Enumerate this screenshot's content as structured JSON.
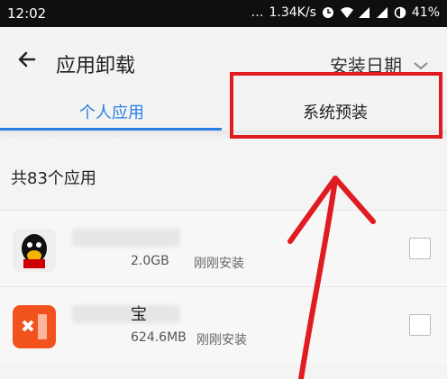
{
  "status": {
    "time": "12:02",
    "network_speed": "1.34K/s",
    "battery_level": "41%"
  },
  "header": {
    "title": "应用卸载",
    "sort_label": "安装日期",
    "tabs": [
      {
        "label": "个人应用",
        "active": true
      },
      {
        "label": "系统预装",
        "active": false
      }
    ]
  },
  "app_count": "共83个应用",
  "apps": [
    {
      "name_suffix": "",
      "size": "2.0GB",
      "install_status": "刚刚安装"
    },
    {
      "name_suffix": "宝",
      "size": "624.6MB",
      "install_status": "刚刚安装"
    }
  ],
  "colors": {
    "accent": "#2a7fe0",
    "annotation": "#e01b22"
  },
  "icons": [
    "back-arrow-icon",
    "chevron-down-icon",
    "clock-icon",
    "wifi-icon",
    "signal-icon",
    "battery-icon"
  ]
}
